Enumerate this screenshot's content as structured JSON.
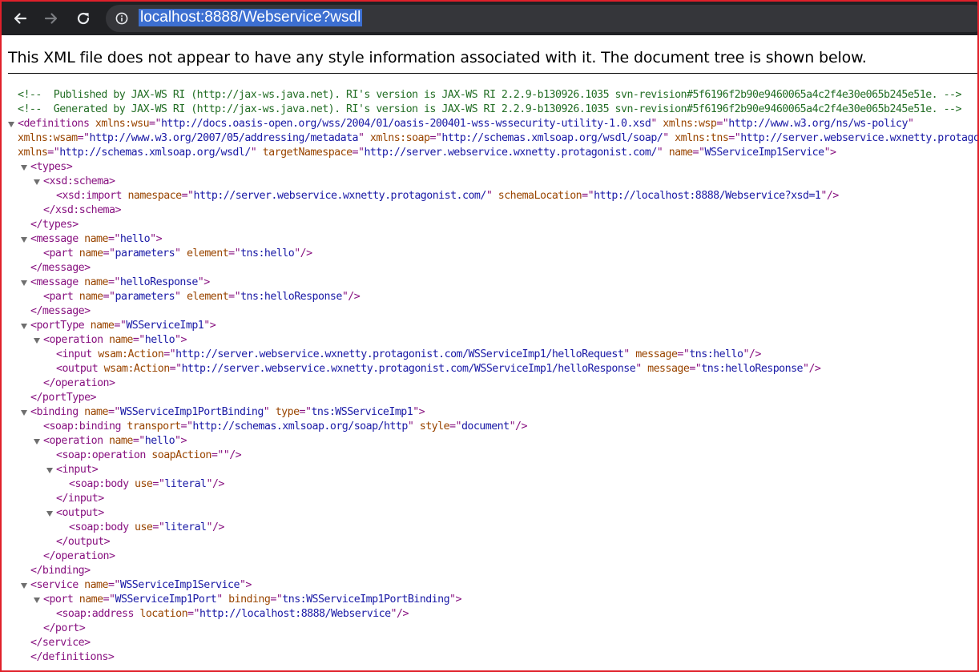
{
  "browser": {
    "url": "localhost:8888/Webservice?wsdl",
    "back_icon": "arrow-left",
    "forward_icon": "arrow-right",
    "reload_icon": "refresh",
    "info_icon": "info-circle"
  },
  "xml_notice": "This XML file does not appear to have any style information associated with it. The document tree is shown below.",
  "colors": {
    "toolbar": "#202124",
    "omnibox": "#35363a",
    "url_highlight": "#3c6fd1",
    "tag": "#881280",
    "attr_name": "#994500",
    "attr_value": "#1a1aa6",
    "comment": "#236e25",
    "border": "#e0202a"
  },
  "tree": [
    {
      "indent": 0,
      "toggle": false,
      "parts": [
        [
          "c",
          "<!--  Published by JAX-WS RI (http://jax-ws.java.net). RI's version is JAX-WS RI 2.2.9-b130926.1035 svn-revision#5f6196f2b90e9460065a4c2f4e30e065b245e51e. -->"
        ]
      ]
    },
    {
      "indent": 0,
      "toggle": false,
      "parts": [
        [
          "c",
          "<!--  Generated by JAX-WS RI (http://jax-ws.java.net). RI's version is JAX-WS RI 2.2.9-b130926.1035 svn-revision#5f6196f2b90e9460065a4c2f4e30e065b245e51e. -->"
        ]
      ]
    },
    {
      "indent": 0,
      "toggle": true,
      "parts": [
        [
          "t",
          "<definitions"
        ],
        [
          "a",
          " xmlns:wsu"
        ],
        [
          "t",
          "=\""
        ],
        [
          "v",
          "http://docs.oasis-open.org/wss/2004/01/oasis-200401-wss-wssecurity-utility-1.0.xsd"
        ],
        [
          "t",
          "\""
        ],
        [
          "a",
          " xmlns:wsp"
        ],
        [
          "t",
          "=\""
        ],
        [
          "v",
          "http://www.w3.org/ns/ws-policy"
        ],
        [
          "t",
          "\""
        ]
      ]
    },
    {
      "indent": 0,
      "toggle": false,
      "parts": [
        [
          "a",
          "xmlns:wsam"
        ],
        [
          "t",
          "=\""
        ],
        [
          "v",
          "http://www.w3.org/2007/05/addressing/metadata"
        ],
        [
          "t",
          "\""
        ],
        [
          "a",
          " xmlns:soap"
        ],
        [
          "t",
          "=\""
        ],
        [
          "v",
          "http://schemas.xmlsoap.org/wsdl/soap/"
        ],
        [
          "t",
          "\""
        ],
        [
          "a",
          " xmlns:tns"
        ],
        [
          "t",
          "=\""
        ],
        [
          "v",
          "http://server.webservice.wxnetty.protagonist.com/"
        ],
        [
          "t",
          "\""
        ]
      ]
    },
    {
      "indent": 0,
      "toggle": false,
      "parts": [
        [
          "a",
          "xmlns"
        ],
        [
          "t",
          "=\""
        ],
        [
          "v",
          "http://schemas.xmlsoap.org/wsdl/"
        ],
        [
          "t",
          "\""
        ],
        [
          "a",
          " targetNamespace"
        ],
        [
          "t",
          "=\""
        ],
        [
          "v",
          "http://server.webservice.wxnetty.protagonist.com/"
        ],
        [
          "t",
          "\""
        ],
        [
          "a",
          " name"
        ],
        [
          "t",
          "=\""
        ],
        [
          "v",
          "WSServiceImp1Service"
        ],
        [
          "t",
          "\">"
        ]
      ]
    },
    {
      "indent": 1,
      "toggle": true,
      "parts": [
        [
          "t",
          "<types>"
        ]
      ]
    },
    {
      "indent": 2,
      "toggle": true,
      "parts": [
        [
          "t",
          "<xsd:schema>"
        ]
      ]
    },
    {
      "indent": 3,
      "toggle": false,
      "parts": [
        [
          "t",
          "<xsd:import"
        ],
        [
          "a",
          " namespace"
        ],
        [
          "t",
          "=\""
        ],
        [
          "v",
          "http://server.webservice.wxnetty.protagonist.com/"
        ],
        [
          "t",
          "\""
        ],
        [
          "a",
          " schemaLocation"
        ],
        [
          "t",
          "=\""
        ],
        [
          "v",
          "http://localhost:8888/Webservice?xsd=1"
        ],
        [
          "t",
          "\"/>"
        ]
      ]
    },
    {
      "indent": 2,
      "toggle": false,
      "parts": [
        [
          "t",
          "</xsd:schema>"
        ]
      ]
    },
    {
      "indent": 1,
      "toggle": false,
      "parts": [
        [
          "t",
          "</types>"
        ]
      ]
    },
    {
      "indent": 1,
      "toggle": true,
      "parts": [
        [
          "t",
          "<message"
        ],
        [
          "a",
          " name"
        ],
        [
          "t",
          "=\""
        ],
        [
          "v",
          "hello"
        ],
        [
          "t",
          "\">"
        ]
      ]
    },
    {
      "indent": 2,
      "toggle": false,
      "parts": [
        [
          "t",
          "<part"
        ],
        [
          "a",
          " name"
        ],
        [
          "t",
          "=\""
        ],
        [
          "v",
          "parameters"
        ],
        [
          "t",
          "\""
        ],
        [
          "a",
          " element"
        ],
        [
          "t",
          "=\""
        ],
        [
          "v",
          "tns:hello"
        ],
        [
          "t",
          "\"/>"
        ]
      ]
    },
    {
      "indent": 1,
      "toggle": false,
      "parts": [
        [
          "t",
          "</message>"
        ]
      ]
    },
    {
      "indent": 1,
      "toggle": true,
      "parts": [
        [
          "t",
          "<message"
        ],
        [
          "a",
          " name"
        ],
        [
          "t",
          "=\""
        ],
        [
          "v",
          "helloResponse"
        ],
        [
          "t",
          "\">"
        ]
      ]
    },
    {
      "indent": 2,
      "toggle": false,
      "parts": [
        [
          "t",
          "<part"
        ],
        [
          "a",
          " name"
        ],
        [
          "t",
          "=\""
        ],
        [
          "v",
          "parameters"
        ],
        [
          "t",
          "\""
        ],
        [
          "a",
          " element"
        ],
        [
          "t",
          "=\""
        ],
        [
          "v",
          "tns:helloResponse"
        ],
        [
          "t",
          "\"/>"
        ]
      ]
    },
    {
      "indent": 1,
      "toggle": false,
      "parts": [
        [
          "t",
          "</message>"
        ]
      ]
    },
    {
      "indent": 1,
      "toggle": true,
      "parts": [
        [
          "t",
          "<portType"
        ],
        [
          "a",
          " name"
        ],
        [
          "t",
          "=\""
        ],
        [
          "v",
          "WSServiceImp1"
        ],
        [
          "t",
          "\">"
        ]
      ]
    },
    {
      "indent": 2,
      "toggle": true,
      "parts": [
        [
          "t",
          "<operation"
        ],
        [
          "a",
          " name"
        ],
        [
          "t",
          "=\""
        ],
        [
          "v",
          "hello"
        ],
        [
          "t",
          "\">"
        ]
      ]
    },
    {
      "indent": 3,
      "toggle": false,
      "parts": [
        [
          "t",
          "<input"
        ],
        [
          "a",
          " wsam:Action"
        ],
        [
          "t",
          "=\""
        ],
        [
          "v",
          "http://server.webservice.wxnetty.protagonist.com/WSServiceImp1/helloRequest"
        ],
        [
          "t",
          "\""
        ],
        [
          "a",
          " message"
        ],
        [
          "t",
          "=\""
        ],
        [
          "v",
          "tns:hello"
        ],
        [
          "t",
          "\"/>"
        ]
      ]
    },
    {
      "indent": 3,
      "toggle": false,
      "parts": [
        [
          "t",
          "<output"
        ],
        [
          "a",
          " wsam:Action"
        ],
        [
          "t",
          "=\""
        ],
        [
          "v",
          "http://server.webservice.wxnetty.protagonist.com/WSServiceImp1/helloResponse"
        ],
        [
          "t",
          "\""
        ],
        [
          "a",
          " message"
        ],
        [
          "t",
          "=\""
        ],
        [
          "v",
          "tns:helloResponse"
        ],
        [
          "t",
          "\"/>"
        ]
      ]
    },
    {
      "indent": 2,
      "toggle": false,
      "parts": [
        [
          "t",
          "</operation>"
        ]
      ]
    },
    {
      "indent": 1,
      "toggle": false,
      "parts": [
        [
          "t",
          "</portType>"
        ]
      ]
    },
    {
      "indent": 1,
      "toggle": true,
      "parts": [
        [
          "t",
          "<binding"
        ],
        [
          "a",
          " name"
        ],
        [
          "t",
          "=\""
        ],
        [
          "v",
          "WSServiceImp1PortBinding"
        ],
        [
          "t",
          "\""
        ],
        [
          "a",
          " type"
        ],
        [
          "t",
          "=\""
        ],
        [
          "v",
          "tns:WSServiceImp1"
        ],
        [
          "t",
          "\">"
        ]
      ]
    },
    {
      "indent": 2,
      "toggle": false,
      "parts": [
        [
          "t",
          "<soap:binding"
        ],
        [
          "a",
          " transport"
        ],
        [
          "t",
          "=\""
        ],
        [
          "v",
          "http://schemas.xmlsoap.org/soap/http"
        ],
        [
          "t",
          "\""
        ],
        [
          "a",
          " style"
        ],
        [
          "t",
          "=\""
        ],
        [
          "v",
          "document"
        ],
        [
          "t",
          "\"/>"
        ]
      ]
    },
    {
      "indent": 2,
      "toggle": true,
      "parts": [
        [
          "t",
          "<operation"
        ],
        [
          "a",
          " name"
        ],
        [
          "t",
          "=\""
        ],
        [
          "v",
          "hello"
        ],
        [
          "t",
          "\">"
        ]
      ]
    },
    {
      "indent": 3,
      "toggle": false,
      "parts": [
        [
          "t",
          "<soap:operation"
        ],
        [
          "a",
          " soapAction"
        ],
        [
          "t",
          "=\"\"/>"
        ]
      ]
    },
    {
      "indent": 3,
      "toggle": true,
      "parts": [
        [
          "t",
          "<input>"
        ]
      ]
    },
    {
      "indent": 4,
      "toggle": false,
      "parts": [
        [
          "t",
          "<soap:body"
        ],
        [
          "a",
          " use"
        ],
        [
          "t",
          "=\""
        ],
        [
          "v",
          "literal"
        ],
        [
          "t",
          "\"/>"
        ]
      ]
    },
    {
      "indent": 3,
      "toggle": false,
      "parts": [
        [
          "t",
          "</input>"
        ]
      ]
    },
    {
      "indent": 3,
      "toggle": true,
      "parts": [
        [
          "t",
          "<output>"
        ]
      ]
    },
    {
      "indent": 4,
      "toggle": false,
      "parts": [
        [
          "t",
          "<soap:body"
        ],
        [
          "a",
          " use"
        ],
        [
          "t",
          "=\""
        ],
        [
          "v",
          "literal"
        ],
        [
          "t",
          "\"/>"
        ]
      ]
    },
    {
      "indent": 3,
      "toggle": false,
      "parts": [
        [
          "t",
          "</output>"
        ]
      ]
    },
    {
      "indent": 2,
      "toggle": false,
      "parts": [
        [
          "t",
          "</operation>"
        ]
      ]
    },
    {
      "indent": 1,
      "toggle": false,
      "parts": [
        [
          "t",
          "</binding>"
        ]
      ]
    },
    {
      "indent": 1,
      "toggle": true,
      "parts": [
        [
          "t",
          "<service"
        ],
        [
          "a",
          " name"
        ],
        [
          "t",
          "=\""
        ],
        [
          "v",
          "WSServiceImp1Service"
        ],
        [
          "t",
          "\">"
        ]
      ]
    },
    {
      "indent": 2,
      "toggle": true,
      "parts": [
        [
          "t",
          "<port"
        ],
        [
          "a",
          " name"
        ],
        [
          "t",
          "=\""
        ],
        [
          "v",
          "WSServiceImp1Port"
        ],
        [
          "t",
          "\""
        ],
        [
          "a",
          " binding"
        ],
        [
          "t",
          "=\""
        ],
        [
          "v",
          "tns:WSServiceImp1PortBinding"
        ],
        [
          "t",
          "\">"
        ]
      ]
    },
    {
      "indent": 3,
      "toggle": false,
      "parts": [
        [
          "t",
          "<soap:address"
        ],
        [
          "a",
          " location"
        ],
        [
          "t",
          "=\""
        ],
        [
          "v",
          "http://localhost:8888/Webservice"
        ],
        [
          "t",
          "\"/>"
        ]
      ]
    },
    {
      "indent": 2,
      "toggle": false,
      "parts": [
        [
          "t",
          "</port>"
        ]
      ]
    },
    {
      "indent": 1,
      "toggle": false,
      "parts": [
        [
          "t",
          "</service>"
        ]
      ]
    },
    {
      "indent": 1,
      "toggle": false,
      "parts": [
        [
          "t",
          "</definitions>"
        ]
      ]
    }
  ]
}
